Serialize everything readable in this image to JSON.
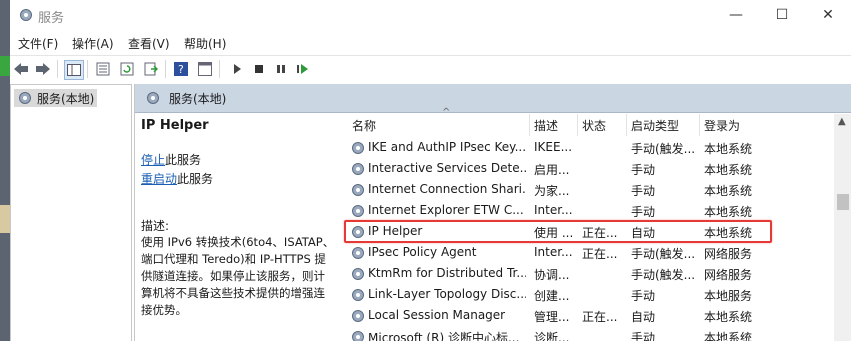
{
  "window": {
    "title": "服务"
  },
  "window_controls": {
    "minimize": "—",
    "maximize": "☐",
    "close": "✕"
  },
  "menu": [
    "文件(F)",
    "操作(A)",
    "查看(V)",
    "帮助(H)"
  ],
  "tree": {
    "root": "服务(本地)"
  },
  "panel": {
    "header": "服务(本地)",
    "service_name": "IP Helper",
    "stop_link": "停止",
    "stop_suffix": "此服务",
    "restart_link": "重启动",
    "restart_suffix": "此服务",
    "desc_label": "描述:",
    "desc_lines": [
      "使用 IPv6 转换技术(6to4、ISATAP、",
      "端口代理和 Teredo)和 IP-HTTPS 提",
      "供隧道连接。如果停止该服务，则计",
      "算机将不具备这些技术提供的增强连",
      "接优势。"
    ]
  },
  "columns": {
    "name": "名称",
    "description": "描述",
    "status": "状态",
    "startup": "启动类型",
    "logon": "登录为",
    "sort_indicator": "^"
  },
  "rows": [
    {
      "name": "IKE and AuthIP IPsec Key...",
      "desc": "IKEE...",
      "status": "",
      "startup": "手动(触发...",
      "logon": "本地系统"
    },
    {
      "name": "Interactive Services Dete...",
      "desc": "启用...",
      "status": "",
      "startup": "手动",
      "logon": "本地系统"
    },
    {
      "name": "Internet Connection Shari...",
      "desc": "为家...",
      "status": "",
      "startup": "手动",
      "logon": "本地系统"
    },
    {
      "name": "Internet Explorer ETW C...",
      "desc": "Inter...",
      "status": "",
      "startup": "手动",
      "logon": "本地系统"
    },
    {
      "name": "IP Helper",
      "desc": "使用 ...",
      "status": "正在...",
      "startup": "自动",
      "logon": "本地系统"
    },
    {
      "name": "IPsec Policy Agent",
      "desc": "Inter...",
      "status": "正在...",
      "startup": "手动(触发...",
      "logon": "网络服务"
    },
    {
      "name": "KtmRm for Distributed Tr...",
      "desc": "协调...",
      "status": "",
      "startup": "手动(触发...",
      "logon": "网络服务"
    },
    {
      "name": "Link-Layer Topology Disc...",
      "desc": "创建...",
      "status": "",
      "startup": "手动",
      "logon": "本地服务"
    },
    {
      "name": "Local Session Manager",
      "desc": "管理...",
      "status": "正在...",
      "startup": "自动",
      "logon": "本地系统"
    },
    {
      "name": "Microsoft (R) 诊断中心标...",
      "desc": "诊断...",
      "status": "",
      "startup": "手动",
      "logon": "本地系统"
    }
  ],
  "colors": {
    "highlight": "#e53935",
    "header_bg": "#cbd6e3",
    "link": "#1a5fb4"
  }
}
